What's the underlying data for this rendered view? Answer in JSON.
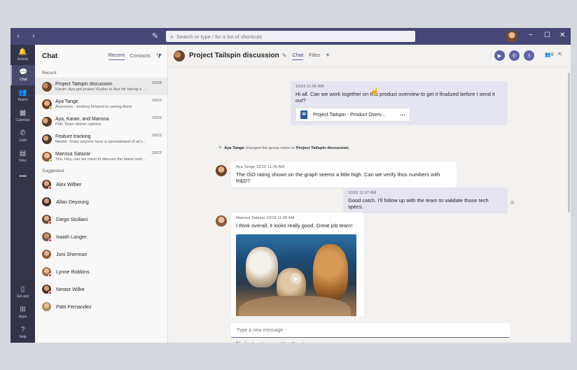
{
  "topbar": {
    "back": "‹",
    "forward": "›",
    "search_placeholder": "Search or type / for a list of shortcuts",
    "minimize": "−",
    "maximize": "☐",
    "close": "✕"
  },
  "rail": {
    "items": [
      {
        "label": "Activity",
        "icon": "🔔"
      },
      {
        "label": "Chat",
        "icon": "💬"
      },
      {
        "label": "Teams",
        "icon": "👥"
      },
      {
        "label": "Calendar",
        "icon": "▦"
      },
      {
        "label": "Calls",
        "icon": "✆"
      },
      {
        "label": "Files",
        "icon": "▤"
      },
      {
        "label": "",
        "icon": "•••"
      }
    ],
    "bottom": [
      {
        "label": "Get app",
        "icon": "▯"
      },
      {
        "label": "Apps",
        "icon": "⊞"
      },
      {
        "label": "Help",
        "icon": "?"
      }
    ]
  },
  "list": {
    "title": "Chat",
    "tab_recent": "Recent",
    "tab_contacts": "Contacts",
    "recent_label": "Recent",
    "suggested_label": "Suggested",
    "conversations": [
      {
        "name": "Project Tailspin discussion",
        "preview": "Karan: Aya got praise! Kudos to Aya for taking a ...",
        "time": "10/28"
      },
      {
        "name": "Aya Tange",
        "preview": "Awesome - looking forward to seeing them",
        "time": "10/22"
      },
      {
        "name": "Aya, Karan, and Marissa",
        "preview": "Poll: Team dinner options",
        "time": "10/22"
      },
      {
        "name": "Feature tracking",
        "preview": "Nestor: Does anyone have a spreadsheet of all t...",
        "time": "10/22"
      },
      {
        "name": "Marissa Salazar",
        "preview": "You: Hey, can we meet to discuss the latest num...",
        "time": "10/22"
      }
    ],
    "suggested": [
      {
        "name": "Alex Wilber"
      },
      {
        "name": "Allan Deyoung"
      },
      {
        "name": "Diego Siciliani"
      },
      {
        "name": "Isaiah Langer"
      },
      {
        "name": "Joni Sherman"
      },
      {
        "name": "Lynne Robbins"
      },
      {
        "name": "Nestor Wilke"
      },
      {
        "name": "Patti Fernandez"
      }
    ]
  },
  "chat": {
    "title": "Project Tailspin discussion",
    "tab_chat": "Chat",
    "tab_files": "Files",
    "participants_count": "8",
    "messages": {
      "m1_meta": "10/16 11:06 AM",
      "m1_text": "Hi all.  Can we work together on this product overview to get it finalized before I send it out?",
      "m1_file": "Project Tailspin - Product Overv...",
      "sys_actor": "Aya Tange",
      "sys_text": "changed the group name to",
      "sys_name": "Project Tailspin discussion.",
      "m2_meta": "Aya Tange  10/16 11:06 AM",
      "m2_text": "The ISO rating shown on the graph seems a little high.  Can we verify thos numbers with R&D?",
      "m3_meta": "10/16 11:07 AM",
      "m3_text": "Good catch.  I'll follow up with the team to validate those tech specs.",
      "m4_meta": "Marissa Salazar  10/16 11:08 AM",
      "m4_text": "I think overall, it looks really good.  Great job team!"
    },
    "composer_placeholder": "Type a new message"
  }
}
